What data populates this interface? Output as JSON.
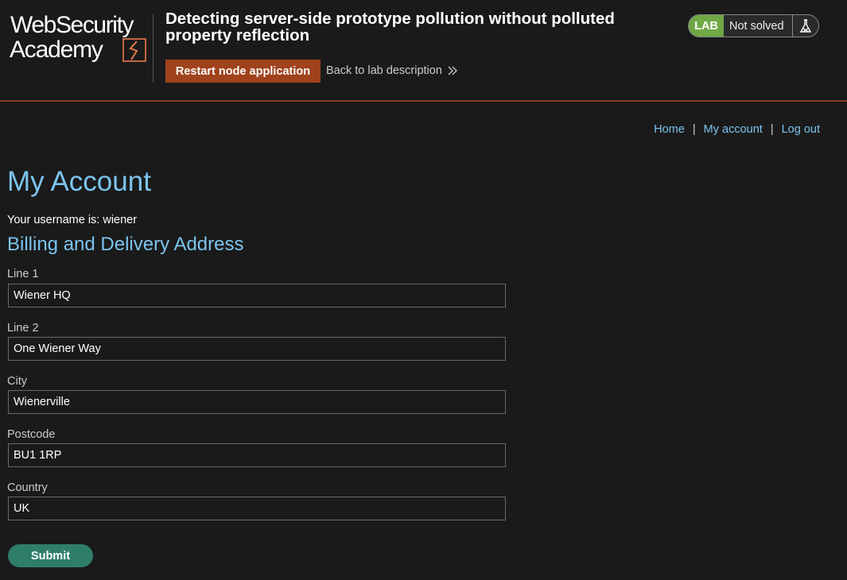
{
  "header": {
    "logo_line1": "WebSecurity",
    "logo_line2": "Academy",
    "lab_title": "Detecting server-side prototype pollution without polluted property reflection",
    "restart_label": "Restart node application",
    "back_label": "Back to lab description",
    "status": {
      "badge": "LAB",
      "text": "Not solved",
      "icon": "flask-icon"
    }
  },
  "nav": {
    "home": "Home",
    "separator": "|",
    "my_account": "My account",
    "log_out": "Log out"
  },
  "main": {
    "title": "My Account",
    "username_text": "Your username is: wiener",
    "section_title": "Billing and Delivery Address",
    "fields": [
      {
        "label": "Line 1",
        "value": "Wiener HQ"
      },
      {
        "label": "Line 2",
        "value": "One Wiener Way"
      },
      {
        "label": "City",
        "value": "Wienerville"
      },
      {
        "label": "Postcode",
        "value": "BU1 1RP"
      },
      {
        "label": "Country",
        "value": "UK"
      }
    ],
    "submit_label": "Submit"
  },
  "colors": {
    "background": "#1a1a1a",
    "accent_orange": "#a0421c",
    "link_blue": "#7cc4ee",
    "lab_green": "#70a845",
    "submit_teal": "#2f7e6a"
  }
}
